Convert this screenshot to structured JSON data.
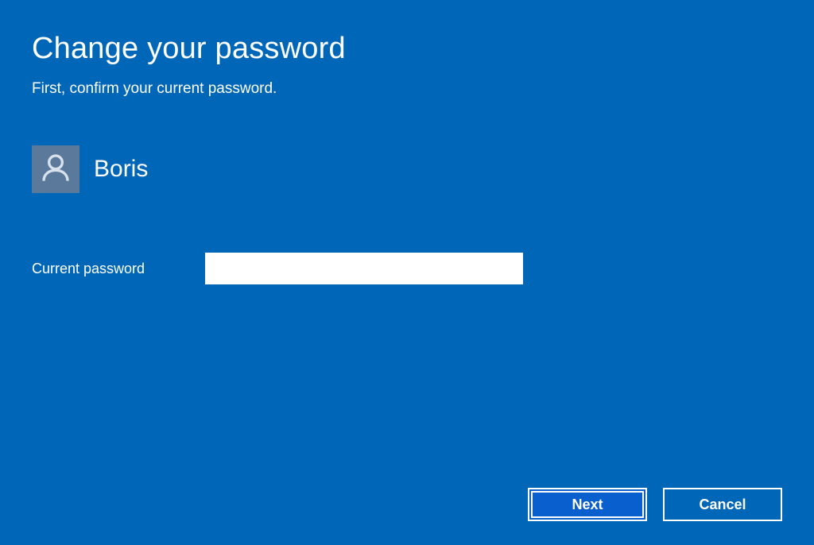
{
  "title": "Change your password",
  "subtitle": "First, confirm your current password.",
  "user": {
    "name": "Boris"
  },
  "field": {
    "label": "Current password",
    "value": ""
  },
  "buttons": {
    "next": "Next",
    "cancel": "Cancel"
  }
}
